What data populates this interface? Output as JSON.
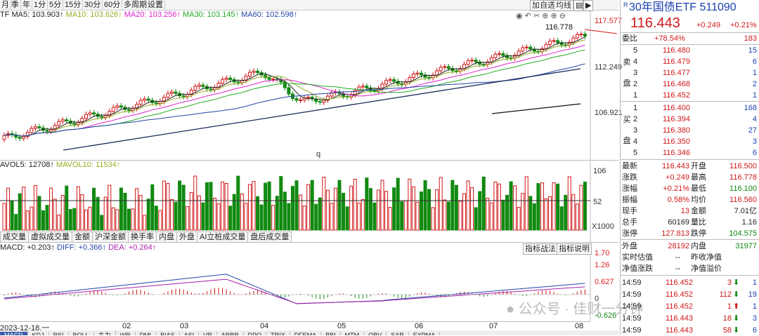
{
  "toolbar": {
    "periods": [
      "月",
      "季",
      "年",
      "1分",
      "5分",
      "15分",
      "30分",
      "60分",
      "多周期",
      "设置"
    ],
    "right_buttons": [
      "加自选",
      "均线"
    ],
    "right_icons": [
      "eye-icon",
      "undo-icon",
      "scissors-icon",
      "plus-circle-icon",
      "minus-circle-icon",
      "zoom-in-icon",
      "zoom-out-icon"
    ]
  },
  "ma_legend": {
    "ma5": "TF MA5: 103.903↑",
    "ma10": "MA10: 103.626↑",
    "ma20": "MA20: 103.256↑",
    "ma30": "MA30: 103.145↑",
    "ma60": "MA60: 102.598↑"
  },
  "price_axis": [
    "117.577",
    "112.249",
    "106.921"
  ],
  "price_annot": {
    "high_label": "116.778",
    "q_mark": "q"
  },
  "volume_legend": {
    "mavol5": "AVOL5: 12708↑",
    "mavol10": "MAVOL10: 11534↑"
  },
  "volume_axis": [
    "106",
    "52",
    "X1000"
  ],
  "tabs": [
    "成交量",
    "虚拟成交量",
    "金额",
    "沪深金额",
    "换手率",
    "内盘",
    "外盘",
    "AI立桩成交量",
    "盘后成交量"
  ],
  "macd_legend": {
    "macd": "MACD: +0.203↑",
    "diff": "DIFF: +0.366↑",
    "dea": "DEA: +0.264↑"
  },
  "macd_buttons": [
    "指标战法",
    "指标说明"
  ],
  "macd_axis": [
    "1.70",
    "1.26",
    "0.627",
    "0",
    "-0.626"
  ],
  "x_axis": {
    "start": "2023-12-18,一",
    "months": [
      "02",
      "03",
      "04",
      "05",
      "06",
      "07",
      "08"
    ]
  },
  "bottom_indicators": [
    "MACD",
    "KDJ",
    "RSI",
    "BOLL",
    "主力",
    "WR",
    "DMI",
    "BIAS",
    "ASI",
    "VR",
    "ARBR",
    "DPO",
    "TRIX",
    "DFEMA",
    "BBI",
    "MTM",
    "OBV",
    "SAR",
    "EXPMA"
  ],
  "watermark": "公众号 · 佳财一分钟",
  "right_panel": {
    "title": "30年国债ETF 511090",
    "price": "116.443",
    "change": "+0.249",
    "change_pct": "+0.21%",
    "weibi_label": "委比",
    "weibi": "+78.54%",
    "weicha": "183",
    "sell_label": [
      "卖",
      "盘"
    ],
    "buy_label": [
      "买",
      "盘"
    ],
    "sells": [
      {
        "lvl": "5",
        "price": "116.480",
        "vol": "15"
      },
      {
        "lvl": "4",
        "price": "116.479",
        "vol": "6"
      },
      {
        "lvl": "3",
        "price": "116.477",
        "vol": "1"
      },
      {
        "lvl": "2",
        "price": "116.468",
        "vol": "2"
      },
      {
        "lvl": "1",
        "price": "116.452",
        "vol": "1"
      }
    ],
    "buys": [
      {
        "lvl": "1",
        "price": "116.400",
        "vol": "168"
      },
      {
        "lvl": "2",
        "price": "116.394",
        "vol": "4"
      },
      {
        "lvl": "3",
        "price": "116.380",
        "vol": "27"
      },
      {
        "lvl": "4",
        "price": "116.350",
        "vol": "3"
      },
      {
        "lvl": "5",
        "price": "116.346",
        "vol": "6"
      }
    ],
    "stats": [
      {
        "l1": "最新",
        "v1": "116.443",
        "l2": "开盘",
        "v2": "116.500"
      },
      {
        "l1": "涨跌",
        "v1": "+0.249",
        "l2": "最高",
        "v2": "116.778"
      },
      {
        "l1": "涨幅",
        "v1": "+0.21%",
        "l2": "最低",
        "v2": "116.100"
      },
      {
        "l1": "振幅",
        "v1": "0.58%",
        "l2": "均价",
        "v2": "116.560"
      },
      {
        "l1": "现手",
        "v1": "13",
        "l2": "金额",
        "v2": "7.01亿"
      },
      {
        "l1": "总手",
        "v1": "60169",
        "l2": "量比",
        "v2": "1.16"
      },
      {
        "l1": "涨停",
        "v1": "127.813",
        "l2": "跌停",
        "v2": "104.575"
      }
    ],
    "outer": {
      "l1": "外盘",
      "v1": "28192",
      "l2": "内盘",
      "v2": "31977"
    },
    "nav": [
      {
        "l1": "实时估值",
        "v1": "--",
        "l2": "昨收净值",
        "v2": ""
      },
      {
        "l1": "净值涨跌",
        "v1": "--",
        "l2": "净值溢价",
        "v2": ""
      }
    ],
    "ticks": [
      {
        "t": "14:59",
        "p": "116.452",
        "v": "3",
        "d": "1"
      },
      {
        "t": "14:59",
        "p": "116.452",
        "v": "112",
        "d": "19"
      },
      {
        "t": "14:59",
        "p": "116.452",
        "v": "1",
        "d": "1"
      },
      {
        "t": "14:59",
        "p": "116.443",
        "v": "18",
        "d": "3"
      },
      {
        "t": "14:59",
        "p": "116.443",
        "v": "58",
        "d": "6"
      }
    ]
  }
}
